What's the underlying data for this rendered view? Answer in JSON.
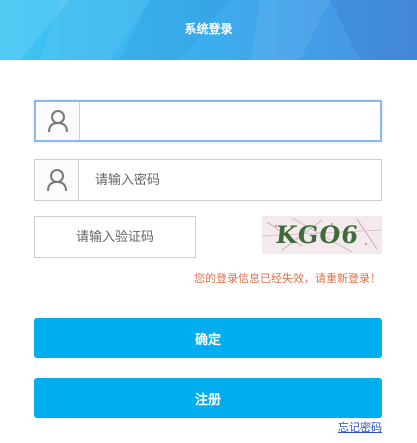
{
  "header": {
    "title": "系统登录"
  },
  "form": {
    "username": {
      "value": "",
      "placeholder": "",
      "icon": "user-icon"
    },
    "password": {
      "value": "",
      "placeholder": "请输入密码",
      "icon": "user-icon"
    },
    "captcha": {
      "value": "",
      "placeholder": "请输入验证码",
      "image_text": "KGO6"
    },
    "error_message": "您的登录信息已经失效，请重新登录！",
    "confirm_label": "确定",
    "register_label": "注册",
    "forgot_label": "忘记密码"
  },
  "colors": {
    "primary": "#00aeef",
    "error": "#e0714b",
    "link": "#2a4fc9",
    "header_start": "#3ec5f3",
    "header_end": "#4a8fe3"
  }
}
